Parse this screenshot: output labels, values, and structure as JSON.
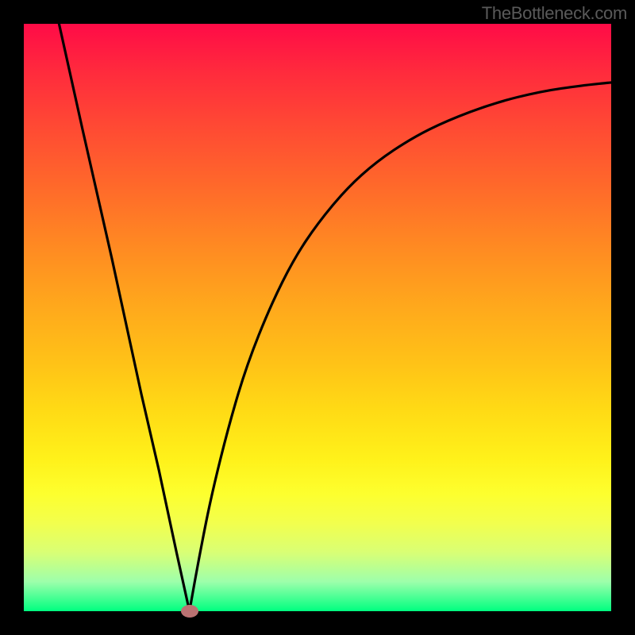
{
  "attribution": "TheBottleneck.com",
  "colors": {
    "frame": "#000000",
    "gradient_top": "#ff0b47",
    "gradient_bottom": "#00ff80",
    "curve_stroke": "#000000",
    "marker_fill": "#b97272"
  },
  "chart_data": {
    "type": "line",
    "title": "",
    "xlabel": "",
    "ylabel": "",
    "xlim": [
      0,
      100
    ],
    "ylim": [
      0,
      100
    ],
    "notes": "Plot area uses a vertical red-to-green gradient. The curve is a V-shaped bottleneck: steep linear descent on the left limb and a diminishing-returns ascent on the right limb. A small red-brown marker sits at the minimum.",
    "series": [
      {
        "name": "left-limb",
        "x": [
          6,
          10,
          15,
          20,
          23,
          26,
          28.2
        ],
        "y": [
          100,
          82,
          60,
          37,
          24,
          10,
          0
        ]
      },
      {
        "name": "right-limb",
        "x": [
          28.2,
          30,
          32,
          35,
          38,
          42,
          46,
          50,
          55,
          60,
          66,
          72,
          80,
          88,
          95,
          100
        ],
        "y": [
          0,
          10,
          20,
          32,
          42,
          52,
          60,
          66,
          72,
          76.5,
          80.5,
          83.5,
          86.5,
          88.5,
          89.5,
          90
        ]
      }
    ],
    "minimum_marker": {
      "x": 28.2,
      "y": 0
    }
  }
}
